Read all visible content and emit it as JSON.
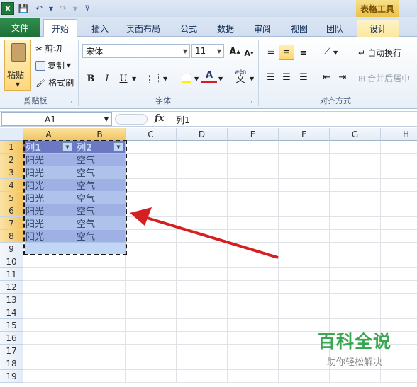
{
  "qat": {
    "app_icon": "X"
  },
  "contextual": {
    "group_label": "表格工具"
  },
  "tabs": [
    "文件",
    "开始",
    "插入",
    "页面布局",
    "公式",
    "数据",
    "审阅",
    "视图",
    "团队",
    "设计"
  ],
  "clipboard": {
    "paste": "粘贴",
    "cut": "剪切",
    "copy": "复制",
    "format_painter": "格式刷",
    "group": "剪贴板"
  },
  "font": {
    "name": "宋体",
    "size": "11",
    "bold": "B",
    "italic": "I",
    "underline": "U",
    "grow": "A",
    "shrink": "A",
    "color_letter": "A",
    "phonetic_top": "wén",
    "phonetic_bottom": "文",
    "group": "字体"
  },
  "alignment": {
    "wrap_text": "自动换行",
    "merge_center": "合并后居中",
    "group": "对齐方式"
  },
  "formula_bar": {
    "cell_ref": "A1",
    "fx": "fx",
    "content": "列1"
  },
  "sheet": {
    "columns": [
      "A",
      "B",
      "C",
      "D",
      "E",
      "F",
      "G",
      "H"
    ],
    "rows": [
      "1",
      "2",
      "3",
      "4",
      "5",
      "6",
      "7",
      "8",
      "9",
      "10",
      "11",
      "12",
      "13",
      "14",
      "15",
      "16",
      "17",
      "18",
      "19"
    ],
    "table_header": [
      "列1",
      "列2"
    ],
    "table_rows": [
      [
        "阳光",
        "空气"
      ],
      [
        "阳光",
        "空气"
      ],
      [
        "阳光",
        "空气"
      ],
      [
        "阳光",
        "空气"
      ],
      [
        "阳光",
        "空气"
      ],
      [
        "阳光",
        "空气"
      ],
      [
        "阳光",
        "空气"
      ]
    ]
  },
  "watermark": {
    "title": "百科全说",
    "subtitle": "助你轻松解决"
  },
  "colors": {
    "table_header": "#7b6fb0",
    "band_dark": "#c9c5e3",
    "band_light": "#e1dff0",
    "arrow": "#d42020",
    "watermark": "#3aa651"
  }
}
